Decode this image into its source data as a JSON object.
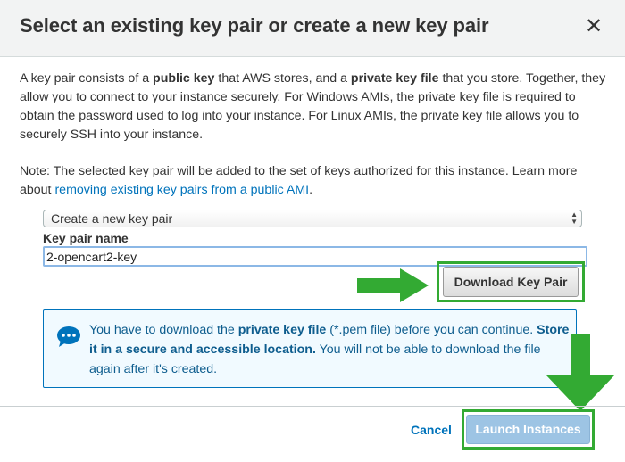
{
  "dialog": {
    "title": "Select an existing key pair or create a new key pair",
    "close_symbol": "✕"
  },
  "intro": {
    "t1": "A key pair consists of a ",
    "b1": "public key",
    "t2": " that AWS stores, and a ",
    "b2": "private key file",
    "t3": " that you store. Together, they allow you to connect to your instance securely. For Windows AMIs, the private key file is required to obtain the password used to log into your instance. For Linux AMIs, the private key file allows you to securely SSH into your instance."
  },
  "note": {
    "text": "Note: The selected key pair will be added to the set of keys authorized for this instance. Learn more about ",
    "link": "removing existing key pairs from a public AMI",
    "end": "."
  },
  "key_pair_select": {
    "value": "Create a new key pair"
  },
  "key_pair_name": {
    "label": "Key pair name",
    "value": "2-opencart2-key"
  },
  "download_button": {
    "label": "Download Key Pair"
  },
  "info_box": {
    "t1": "You have to download the ",
    "b1": "private key file",
    "t2": " (*.pem file) before you can continue. ",
    "b2": "Store it in a secure and accessible location.",
    "t3": " You will not be able to download the file again after it's created."
  },
  "footer": {
    "cancel_label": "Cancel",
    "launch_label": "Launch Instances"
  },
  "colors": {
    "link": "#0073bb",
    "annotation_green": "#33aa33",
    "info_border": "#0073bb",
    "info_text": "#0e5d8e",
    "launch_disabled": "#9dc4e4"
  }
}
